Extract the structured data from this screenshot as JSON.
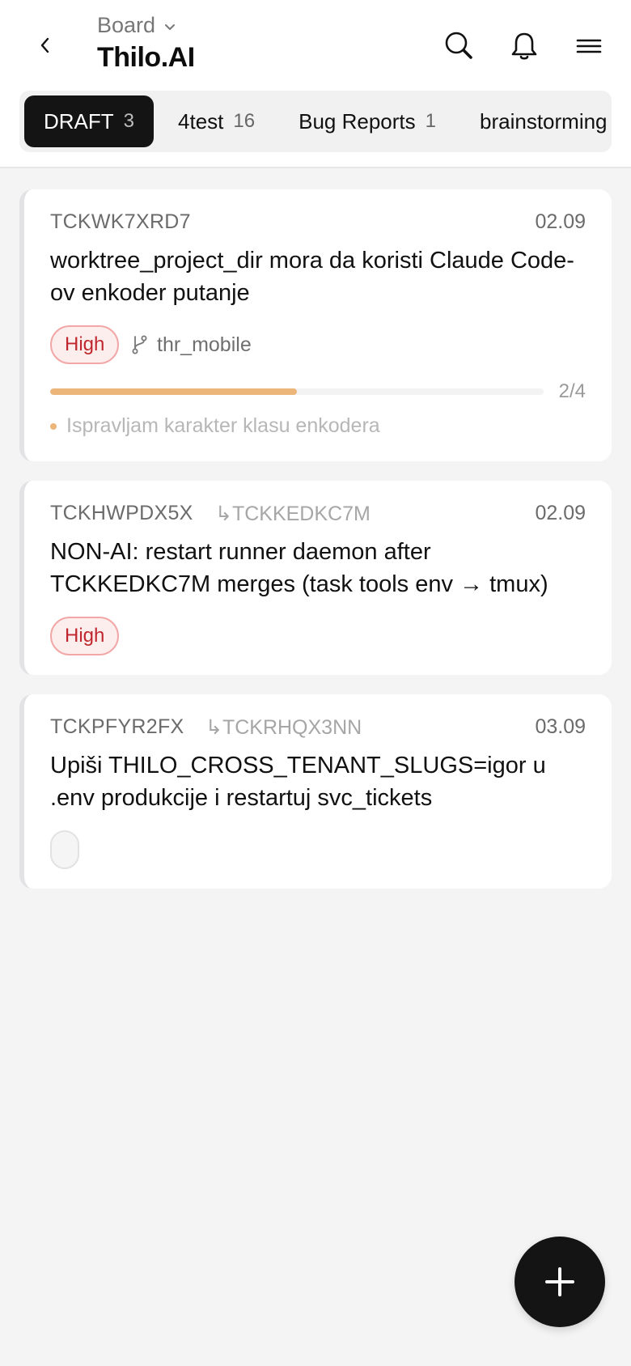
{
  "header": {
    "board_label": "Board",
    "project_title": "Thilo.AI",
    "icons": [
      "chevron-left-icon",
      "chevron-down-icon",
      "search-icon",
      "bell-icon",
      "menu-icon"
    ]
  },
  "tabs": [
    {
      "label": "DRAFT",
      "count": "3",
      "active": true
    },
    {
      "label": "4test",
      "count": "16",
      "active": false
    },
    {
      "label": "Bug Reports",
      "count": "1",
      "active": false
    },
    {
      "label": "brainstorming",
      "count": "",
      "active": false
    }
  ],
  "cards": [
    {
      "id": "TCKWK7XRD7",
      "parent": "",
      "date": "02.09",
      "title": "worktree_project_dir mora da koristi Claude Code-ov enkoder putanje",
      "priority": "High",
      "branch": "thr_mobile",
      "progress_text": "2/4",
      "progress_fraction": 0.5,
      "activity": "Ispravljam karakter klasu enkodera"
    },
    {
      "id": "TCKHWPDX5X",
      "parent": "↳TCKKEDKC7M",
      "date": "02.09",
      "title": "NON-AI: restart runner daemon after TCKKEDKC7M merges (task tools env → tmux)",
      "priority": "High"
    },
    {
      "id": "TCKPFYR2FX",
      "parent": "↳TCKRHQX3NN",
      "date": "03.09",
      "title": "Upiši THILO_CROSS_TENANT_SLUGS=igor u .env produkcije i restartuj svc_tickets",
      "priority": ""
    }
  ],
  "colors": {
    "accent_dark": "#141414",
    "priority_high_text": "#c0262d",
    "priority_high_bg": "#fdeeee",
    "progress": "#ecb57a",
    "background": "#f4f4f5"
  },
  "fab": {
    "icon": "plus-icon"
  }
}
